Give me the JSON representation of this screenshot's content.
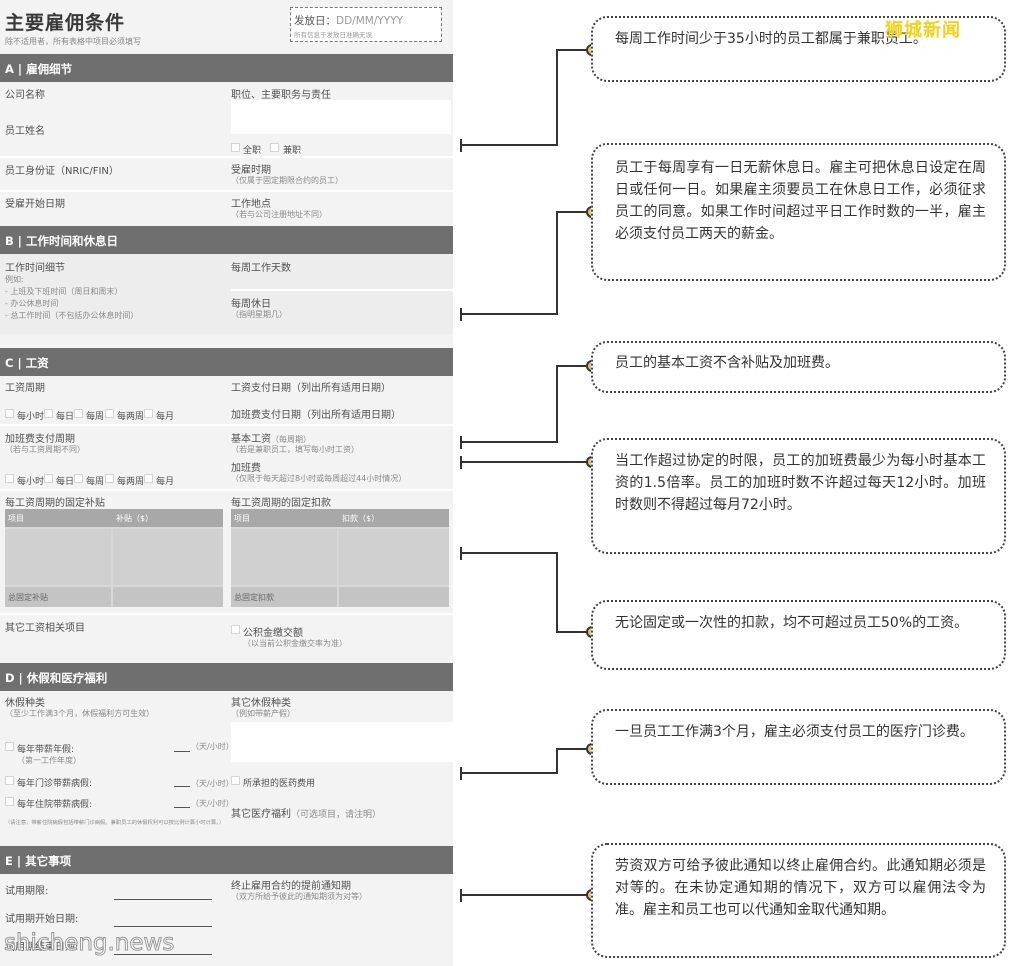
{
  "form": {
    "title": "主要雇佣条件",
    "subtitle": "除不适用者，所有表格中项目必须填写",
    "issue_date_label": "发放日：",
    "issue_date_placeholder": "DD/MM/YYYY",
    "issue_date_note": "所有信息于发放日准确无误",
    "section_a": {
      "header": "A | 雇佣细节",
      "company_name": "公司名称",
      "position": "职位、主要职务与责任",
      "employee_name": "员工姓名",
      "full_time": "全职",
      "part_time": "兼职",
      "id_number": "员工身份证（NRIC/FIN）",
      "employment_period": "受雇时期",
      "employment_period_note": "（仅属于固定期限合约的员工）",
      "start_date": "受雇开始日期",
      "workplace": "工作地点",
      "workplace_note": "（若与公司注册地址不同）"
    },
    "section_b": {
      "header": "B | 工作时间和休息日",
      "hours_detail": "工作时间细节",
      "example": "例如:",
      "ex1": "- 上班及下班时间（周日和周末）",
      "ex2": "- 办公休息时间",
      "ex3": "- 总工作时间（不包括办公休息时间）",
      "days_per_week": "每周工作天数",
      "rest_day": "每周休日",
      "rest_day_note": "（指明星期几）"
    },
    "section_c": {
      "header": "C | 工资",
      "salary_period": "工资周期",
      "salary_payment_date": "工资支付日期（列出所有适用日期）",
      "ot_payment_date": "加班费支付日期（列出所有适用日期）",
      "freq": [
        "每小时",
        "每日",
        "每周",
        "每两周",
        "每月"
      ],
      "ot_period": "加班费支付周期",
      "ot_period_note": "（若与工资周期不同）",
      "basic_salary": "基本工资",
      "basic_salary_unit": "（每周期）",
      "basic_salary_note": "（若是兼职员工，填写每小时工资）",
      "overtime_pay": "加班费",
      "overtime_pay_note": "（仅限于每天超过8小时或每周超过44小时情况）",
      "fixed_allowance": "每工资周期的固定补贴",
      "fixed_deduction": "每工资周期的固定扣款",
      "item": "项目",
      "allowance_amount": "补贴（$）",
      "deduction_amount": "扣款（$）",
      "total_allowance": "总固定补贴",
      "total_deduction": "总固定扣款",
      "other_salary": "其它工资相关项目",
      "cpf": "公积金缴交额",
      "cpf_note": "（以当前公积金缴交率为准）"
    },
    "section_d": {
      "header": "D | 休假和医疗福利",
      "leave_type": "休假种类",
      "leave_type_note": "（至少工作满3个月，休假福利方可生效）",
      "other_leave": "其它休假种类",
      "other_leave_note": "（例如带薪产假）",
      "annual_leave": "每年带薪年假:",
      "annual_leave_note": "（第一工作年度）",
      "outpatient_leave": "每年门诊带薪病假:",
      "hospital_leave": "每年住院带薪病假:",
      "unit": "（天/小时）",
      "medical_fees": "所承担的医药费用",
      "other_medical": "其它医疗福利",
      "other_medical_note": "（可选项目，请注明）",
      "fine_print": "（请注意，带薪住院病假包括带薪门诊病假。兼职员工的休假权利可以按比例计算小时计算。）"
    },
    "section_e": {
      "header": "E | 其它事项",
      "probation": "试用期限:",
      "probation_start": "试用期开始日期:",
      "probation_end": "试用期结束日期:",
      "notice": "终止雇用合约的提前通知期",
      "notice_note": "（双方所给予彼此的通知期须为对等）"
    }
  },
  "callouts": [
    "每周工作时间少于35小时的员工都属于兼职员工。",
    "员工于每周享有一日无薪休息日。雇主可把休息日设定在周日或任何一日。如果雇主须要员工在休息日工作，必须征求员工的同意。如果工作时间超过平日工作时数的一半，雇主必须支付员工两天的薪金。",
    "员工的基本工资不含补贴及加班费。",
    "当工作超过协定的时限，员工的加班费最少为每小时基本工资的1.5倍率。员工的加班时数不许超过每天12小时。加班时数则不得超过每月72小时。",
    "无论固定或一次性的扣款，均不可超过员工50%的工资。",
    "一旦员工工作满3个月，雇主必须支付员工的医疗门诊费。",
    "劳资双方可给予彼此通知以终止雇佣合约。此通知期必须是对等的。在未协定通知期的情况下，双方可以雇佣法令为准。雇主和员工也可以代通知金取代通知期。"
  ],
  "watermarks": {
    "top": "狮城新闻",
    "bottom": "shicheng.news"
  },
  "colors": {
    "section_bar": "#6f6f6f",
    "form_bg": "#f3f3f3",
    "connector": "#333333",
    "knob": "#e3c470",
    "watermark": "#f2d11c"
  }
}
